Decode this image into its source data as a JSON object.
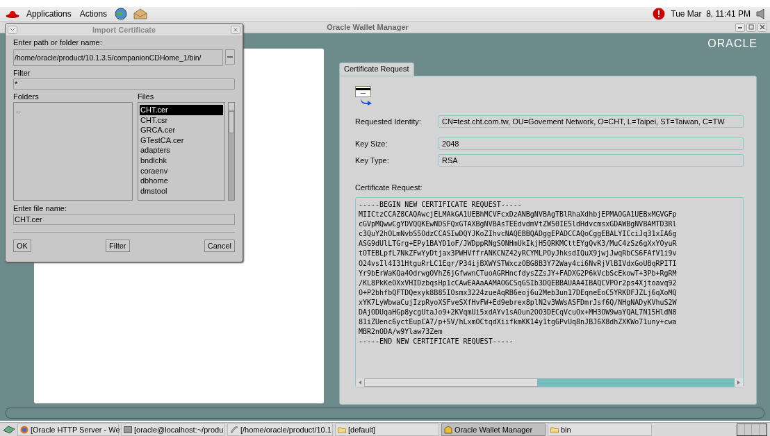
{
  "top_panel": {
    "menus": [
      "Applications",
      "Actions"
    ],
    "clock": "Tue Mar  8, 11:41 PM"
  },
  "window": {
    "title": "Oracle Wallet Manager",
    "logo": "ORACLE"
  },
  "tabs": [
    {
      "label": "Certificate Request",
      "selected": true
    }
  ],
  "certificate": {
    "fields": [
      {
        "label": "Requested Identity:",
        "value": "CN=test.cht.com.tw, OU=Govement Network, O=CHT, L=Taipei, ST=Taiwan, C=TW"
      },
      {
        "label": "Key Size:",
        "value": "2048"
      },
      {
        "label": "Key Type:",
        "value": "RSA"
      }
    ],
    "request_label": "Certificate Request:",
    "request_lines": [
      "-----BEGIN NEW CERTIFICATE REQUEST-----",
      "MIICtzCCAZ8CAQAwcjELMAkGA1UEBhMCVFcxDzANBgNVBAgTBlRhaXdhbjEPMAOGA1UEBxMGVGFp",
      "cGVpMQwwCgYDVQQKEwNDSFQxGTAXBgNVBAsTEEdvdmVtZW50IE5ldHdvcmsxGDAWBgNVBAMTD3Rl",
      "c3QuY2hOLmNvbS5OdzCCASIwDQYJKoZIhvcNAQEBBQADggEPADCCAQoCggEBALYICciJq31xIA6g",
      "ASG9dUlLTGrg+EPy1BAYD1oF/JWDppRNgSONHmUkIkjH5QRKMCttEYgQvK3/MuC4zSz6gXxYOyuR",
      "tOTEBLpfL7NkZFwYyDtjax3PWHVffrANKCNZ42yRCYMLPOyJhksdIQuX9jwjJwqRbCS6FAfV1i9v",
      "O24vsIl4I31HtguRrLC1Eqr/P34ijBXWYSTWxczOBG8B3Y72Way4ci6NvRjVlBIVdxGoUBqRPITI",
      "Yr9bErWaKQa4OdrwgOVhZ6jGfwwnCTuoAGRHncfdysZZsJY+FADXG2P6kVcbScEkowT+3Pb+RgRM",
      "/KL8PkKeOXxVHIDzbqsHp1cCAwEAAaAAMAOGCSqGSIb3DQEBBAUAA4IBAQCVPOr2ps4Xjtoavq92",
      "O+P2bhfbQFTDQexyk8B85IOsmx3224zueAqRB6eoj6u2Meb3un17DEqneEoC5YRKDFJZLj6qXoMQ",
      "xYK7LyWbwaCujIzpRyoXSFveSXfHvFW+Ed9ebrex8plN2v3WWsASFDmrJsf6Q/NHgNADyKVhuS2W",
      "DAjODUqaHGp8ycgUtaJo9+2KVqmUi5xdAYv1sAOun2OO3DECqVcuOx+MH3OW9waYQAL7N15HldN8",
      "81iZUenc6yctEupCA7/p+5V/hLxmOCtqdXiifkmKK14y1tgGPvUq8nJBJ6X8dhZXKWo71uny+cwa",
      "MBR2nODA/w9Ylaw73Zem",
      "-----END NEW CERTIFICATE REQUEST-----"
    ]
  },
  "dialog": {
    "title": "Import Certificate",
    "path_label": "Enter path or folder name:",
    "path": "/home/oracle/product/10.1.3.5/companionCDHome_1/bin/",
    "filter_label": "Filter",
    "filter": "*",
    "folders_label": "Folders",
    "folders": [
      ".."
    ],
    "files_label": "Files",
    "files": [
      {
        "name": "CHT.cer",
        "selected": true
      },
      {
        "name": "CHT.csr",
        "selected": false
      },
      {
        "name": "GRCA.cer",
        "selected": false
      },
      {
        "name": "GTestCA.cer",
        "selected": false
      },
      {
        "name": "adapters",
        "selected": false
      },
      {
        "name": "bndlchk",
        "selected": false
      },
      {
        "name": "coraenv",
        "selected": false
      },
      {
        "name": "dbhome",
        "selected": false
      },
      {
        "name": "dmstool",
        "selected": false
      }
    ],
    "file_label": "Enter file name:",
    "file": "CHT.cer",
    "buttons": [
      "OK",
      "Filter",
      "Cancel"
    ]
  },
  "taskbar": [
    {
      "label": "[Oracle HTTP Server - We",
      "selected": false
    },
    {
      "label": "[oracle@localhost:~/produ",
      "selected": false
    },
    {
      "label": "[/home/oracle/product/10.1",
      "selected": false
    },
    {
      "label": "[default]",
      "selected": false
    },
    {
      "label": "Oracle Wallet Manager",
      "selected": true
    },
    {
      "label": "bin",
      "selected": false
    }
  ]
}
